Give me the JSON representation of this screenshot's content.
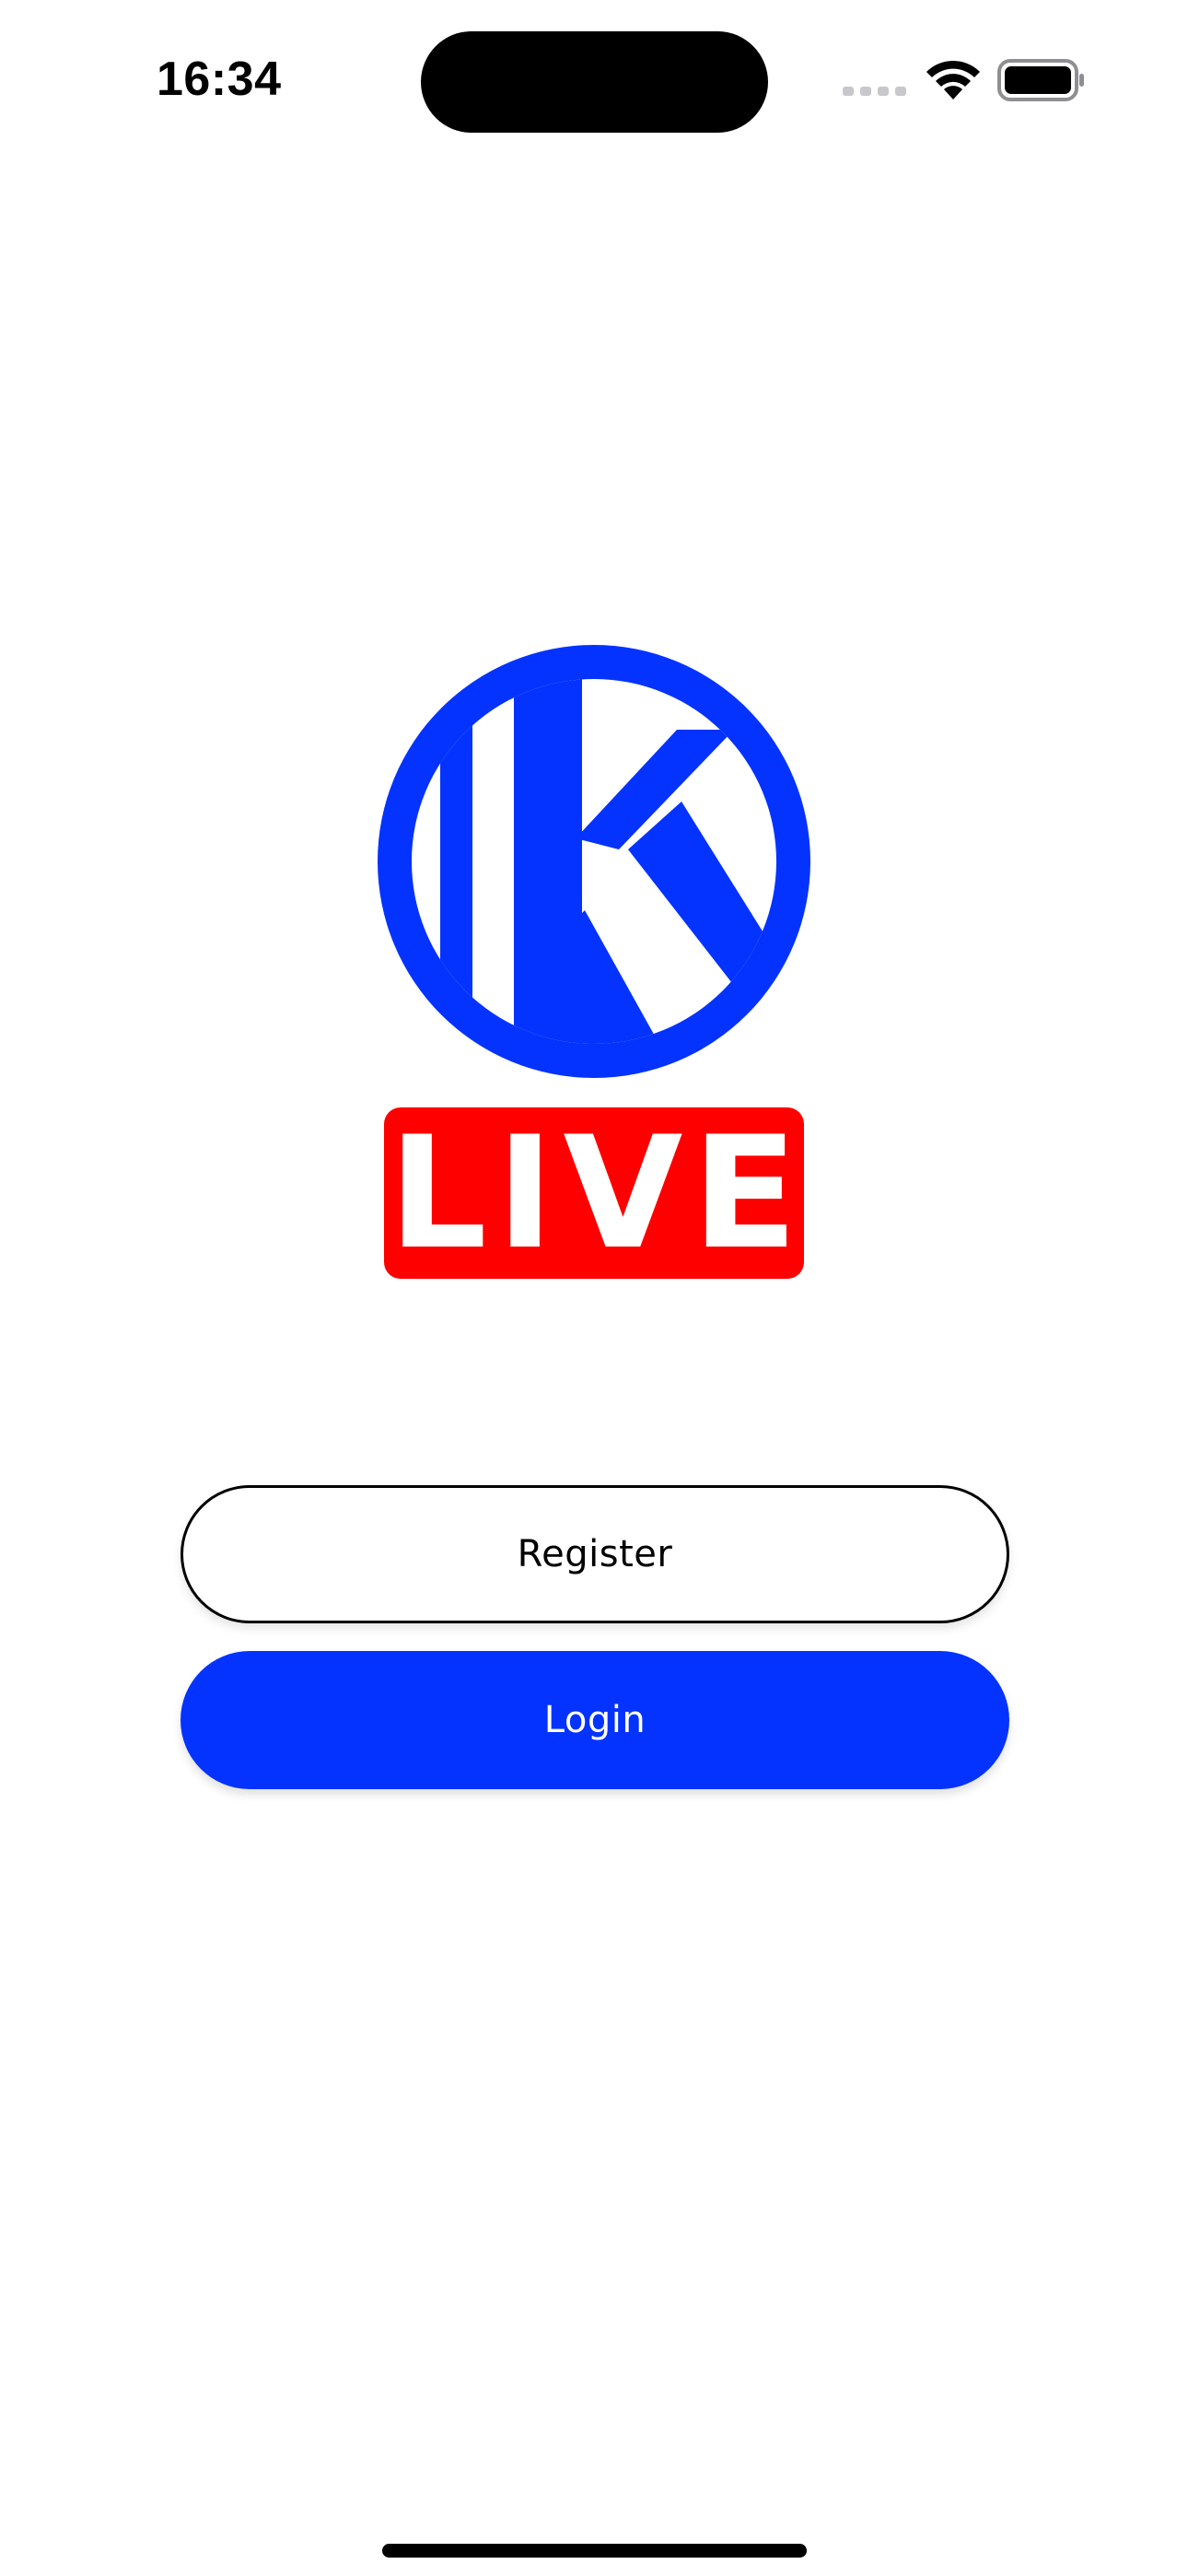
{
  "status_bar": {
    "time": "16:34",
    "signal_icon": "cellular-signal-icon",
    "wifi_icon": "wifi-icon",
    "battery_icon": "battery-icon"
  },
  "logo": {
    "letter": "K",
    "badge_text": "LIVE",
    "brand_color": "#0433ff",
    "badge_color": "#ff0000"
  },
  "actions": {
    "register_label": "Register",
    "login_label": "Login",
    "primary_color": "#0433ff"
  }
}
